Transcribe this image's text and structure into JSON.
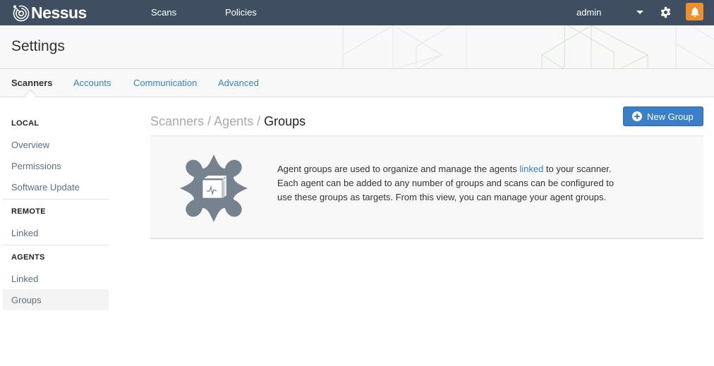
{
  "app": {
    "name": "Nessus"
  },
  "topnav": {
    "links": [
      {
        "label": "Scans"
      },
      {
        "label": "Policies"
      }
    ],
    "user": "admin",
    "icons": {
      "settings": "gear-icon",
      "notifications": "bell-icon",
      "user_menu": "caret-down-icon"
    },
    "notification_color": "#ef8f2b"
  },
  "header": {
    "title": "Settings"
  },
  "tabs": [
    {
      "label": "Scanners",
      "active": true
    },
    {
      "label": "Accounts"
    },
    {
      "label": "Communication"
    },
    {
      "label": "Advanced"
    }
  ],
  "sidebar": {
    "sections": [
      {
        "heading": "LOCAL",
        "items": [
          {
            "label": "Overview"
          },
          {
            "label": "Permissions"
          },
          {
            "label": "Software Update"
          }
        ]
      },
      {
        "heading": "REMOTE",
        "items": [
          {
            "label": "Linked"
          }
        ]
      },
      {
        "heading": "AGENTS",
        "items": [
          {
            "label": "Linked"
          },
          {
            "label": "Groups",
            "active": true
          }
        ]
      }
    ]
  },
  "breadcrumb": {
    "part1": "Scanners",
    "sep": " / ",
    "part2": "Agents",
    "current": "Groups"
  },
  "actions": {
    "new_group": "New Group"
  },
  "info": {
    "icon": "agent-groups-puzzle-icon",
    "text_before": "Agent groups are used to organize and manage the agents ",
    "link": "linked",
    "text_after": " to your scanner. Each agent can be added to any number of groups and scans can be configured to use these groups as targets. From this view, you can manage your agent groups."
  },
  "colors": {
    "topbar": "#3f4f61",
    "link": "#3a81c4",
    "primary_button": "#3a7fc7"
  }
}
